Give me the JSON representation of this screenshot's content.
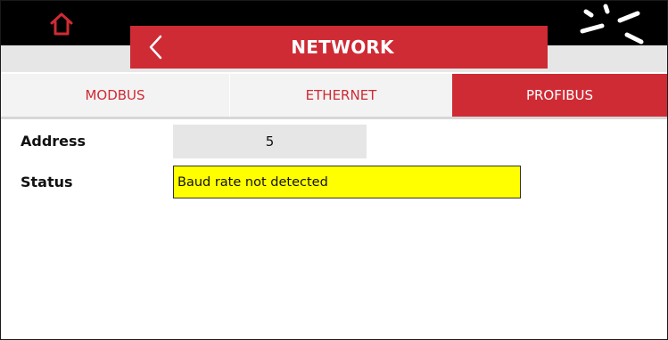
{
  "header": {
    "title": "NETWORK",
    "home_icon": "home-icon",
    "back_icon": "chevron-left-icon",
    "activity_icon": "spinner-icon"
  },
  "tabs": [
    {
      "label": "MODBUS",
      "selected": false
    },
    {
      "label": "ETHERNET",
      "selected": false
    },
    {
      "label": "PROFIBUS",
      "selected": true
    }
  ],
  "fields": {
    "address": {
      "label": "Address",
      "value": "5"
    },
    "status": {
      "label": "Status",
      "value": "Baud rate not detected"
    }
  },
  "colors": {
    "accent": "#cf2b35",
    "top_bar": "#000000",
    "tab_inactive_bg": "#f3f3f3",
    "value_box_bg": "#e6e6e6",
    "status_highlight": "#ffff00"
  }
}
